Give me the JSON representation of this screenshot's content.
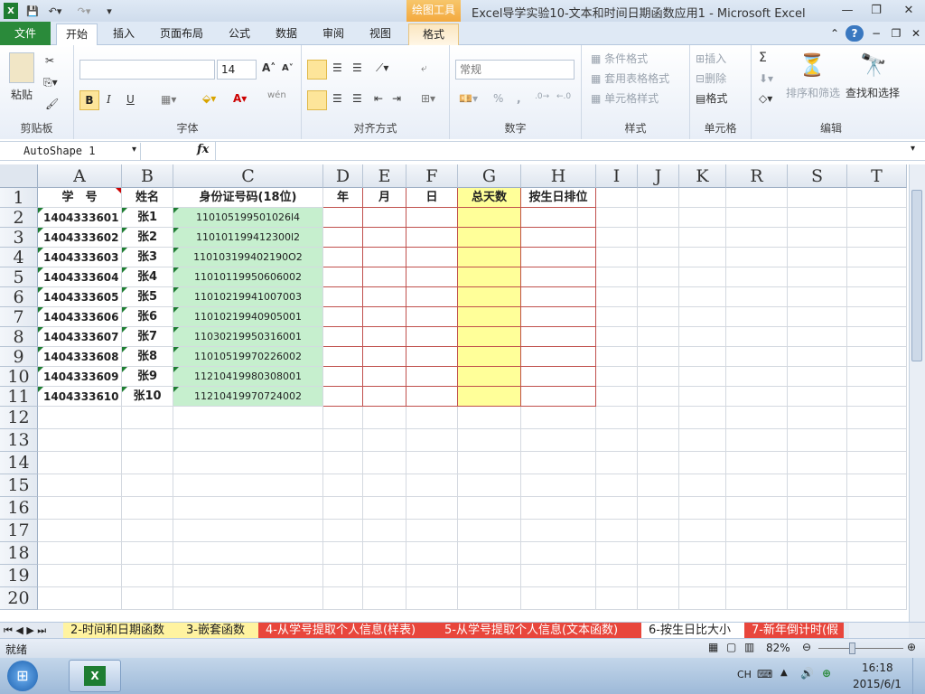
{
  "window": {
    "title": "Excel导学实验10-文本和时间日期函数应用1 - Microsoft Excel",
    "context_tab": "绘图工具"
  },
  "tabs": [
    "文件",
    "开始",
    "插入",
    "页面布局",
    "公式",
    "数据",
    "审阅",
    "视图",
    "格式"
  ],
  "ribbon": {
    "clipboard": {
      "label": "剪贴板",
      "paste": "粘贴"
    },
    "font": {
      "label": "字体",
      "name": "",
      "size": "14",
      "bold": "B",
      "italic": "I",
      "underline": "U",
      "wen": "wén"
    },
    "alignment": {
      "label": "对齐方式"
    },
    "number": {
      "label": "数字",
      "format": "常规",
      "percent": "%",
      "comma": ","
    },
    "styles": {
      "label": "样式",
      "cond": "条件格式",
      "table": "套用表格格式",
      "cell": "单元格样式"
    },
    "cells": {
      "label": "单元格",
      "insert": "插入",
      "delete": "删除",
      "format": "格式"
    },
    "editing": {
      "label": "编辑",
      "sort": "排序和筛选",
      "find": "查找和选择",
      "sigma": "Σ"
    }
  },
  "formula_bar": {
    "name_box": "AutoShape 1",
    "fx": "fx",
    "content": ""
  },
  "columns": [
    "A",
    "B",
    "C",
    "D",
    "E",
    "F",
    "G",
    "H",
    "I",
    "J",
    "K",
    "R",
    "S",
    "T"
  ],
  "rows": [
    "1",
    "2",
    "3",
    "4",
    "5",
    "6",
    "7",
    "8",
    "9",
    "10",
    "11",
    "12",
    "13",
    "14",
    "15",
    "16",
    "17",
    "18",
    "19",
    "20"
  ],
  "table": {
    "headers": [
      "学　号",
      "姓名",
      "身份证号码(18位)",
      "年",
      "月",
      "日",
      "总天数",
      "按生日排位"
    ],
    "data": [
      {
        "id": "1404333601",
        "name": "张1",
        "idno": "110105199501026l4"
      },
      {
        "id": "1404333602",
        "name": "张2",
        "idno": "110101199412300l2"
      },
      {
        "id": "1404333603",
        "name": "张3",
        "idno": "110103199402190O2"
      },
      {
        "id": "1404333604",
        "name": "张4",
        "idno": "11010119950606002"
      },
      {
        "id": "1404333605",
        "name": "张5",
        "idno": "11010219941007003"
      },
      {
        "id": "1404333606",
        "name": "张6",
        "idno": "11010219940905001"
      },
      {
        "id": "1404333607",
        "name": "张7",
        "idno": "11030219950316001"
      },
      {
        "id": "1404333608",
        "name": "张8",
        "idno": "11010519970226002"
      },
      {
        "id": "1404333609",
        "name": "张9",
        "idno": "11210419980308001"
      },
      {
        "id": "1404333610",
        "name": "张10",
        "idno": "11210419970724002"
      }
    ]
  },
  "sheet_tabs": [
    "2-时间和日期函数",
    "3-嵌套函数",
    "4-从学号提取个人信息(样表)",
    "5-从学号提取个人信息(文本函数)",
    "6-按生日比大小",
    "7-新年倒计时(假"
  ],
  "status": {
    "ready": "就绪",
    "zoom": "82%"
  },
  "taskbar": {
    "lang": "CH",
    "time": "16:18",
    "date": "2015/6/1"
  }
}
